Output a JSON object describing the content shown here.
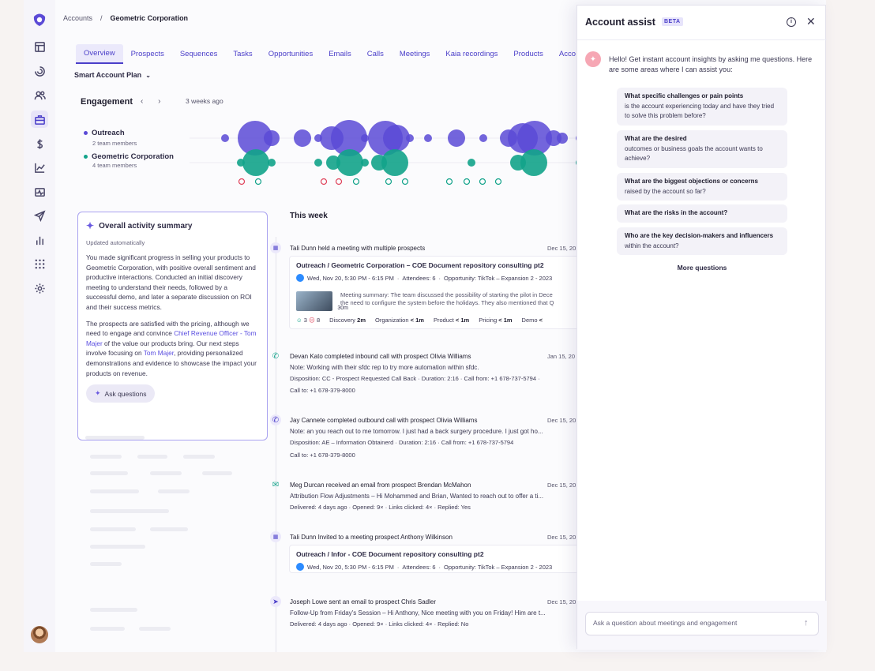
{
  "breadcrumb": {
    "root": "Accounts",
    "sep": "/",
    "current": "Geometric Corporation"
  },
  "tabs": [
    "Overview",
    "Prospects",
    "Sequences",
    "Tasks",
    "Opportunities",
    "Emails",
    "Calls",
    "Meetings",
    "Kaia recordings",
    "Products",
    "Acco"
  ],
  "plan": {
    "label": "Smart Account Plan",
    "chevron": "⌄"
  },
  "engagement": {
    "title": "Engagement",
    "nav": "‹ ›",
    "range": "3 weeks ago",
    "rows": [
      {
        "label": "Outreach",
        "sub": "2 team members",
        "color": "#5b4ad6"
      },
      {
        "label": "Geometric Corporation",
        "sub": "4 team members",
        "color": "#12a38a"
      }
    ]
  },
  "summary": {
    "title": "Overall activity summary",
    "updated": "Updated automatically",
    "p1": "You made significant progress in selling your products to Geometric Corporation, with positive overall sentiment and productive interactions. Conducted an initial discovery meeting to understand their needs, followed by a successful demo, and later a separate discussion on ROI and their success metrics.",
    "p2a": "The prospects are satisfied with the pricing, although we need to engage and convince ",
    "link1": "Chief Revenue Officer - Tom Majer",
    "p2b": " of the value our products bring. Our next steps involve focusing on ",
    "link2": "Tom Majer",
    "p2c": ", providing personalized demonstrations and evidence to showcase the impact your products on revenue.",
    "ask": "Ask questions"
  },
  "timeline": {
    "heading": "This week",
    "e1": {
      "title": "Tali Dunn held a meeting with multiple prospects",
      "date": "Dec 15, 20",
      "card_title": "Outreach / Geometric Corporation – COE Document repository consulting pt2",
      "when": "Wed, Nov 20, 5:30 PM - 6:15 PM",
      "attendees": "Attendees: 6",
      "opportunity": "Opportunity: TikTok – Expansion 2 - 2023",
      "duration": "30m",
      "summary1": "Meeting summary: The team discussed the possibility of starting the pilot in Dece",
      "summary2": "the need to configure the system before the holidays. They also mentioned that Q",
      "pos": "3",
      "neg": "8",
      "s1": "Discovery",
      "v1": "2m",
      "s2": "Organization",
      "v2": "< 1m",
      "s3": "Product",
      "v3": "< 1m",
      "s4": "Pricing",
      "v4": "< 1m",
      "s5": "Demo",
      "v5": "<"
    },
    "e2": {
      "title": "Devan Kato completed inbound call with prospect Olivia Williams",
      "date": "Jan 15, 20",
      "note": "Note: Working with their sfdc rep to try more automation within sfdc.",
      "meta": "Disposition: CC - Prospect Requested Call Back  ·  Duration: 2:16  ·  Call from: +1 678-737-5794  ·",
      "callto": "Call to:  +1 678-379-8000"
    },
    "e3": {
      "title": "Jay Cannete completed outbound call with prospect Olivia Williams",
      "date": "Dec 15, 20",
      "note": "Note: an you reach out to me tomorrow. I just had a back surgery procedure. I just got ho...",
      "meta": "Disposition: AE – Information Obtainerd  ·  Duration: 2:16  ·  Call from: +1 678-737-5794",
      "callto": "Call to:  +1 678-379-8000"
    },
    "e4": {
      "title": "Meg Durcan received an email from prospect Brendan McMahon",
      "date": "Dec 15, 20",
      "line": "Attribution Flow Adjustments – Hi Mohammed and Brian, Wanted to reach out to offer a ti...",
      "meta": "Delivered: 4 days ago  ·  Opened: 9×  ·  Links clicked: 4×  ·  Replied: Yes"
    },
    "e5": {
      "title": "Tali Dunn Invited to a meeting prospect Anthony Wilkinson",
      "date": "Dec 15, 20",
      "card_title": "Outreach / Infor - COE Document repository consulting pt2",
      "when": "Wed, Nov 20, 5:30 PM - 6:15 PM",
      "attendees": "Attendees: 6",
      "opportunity": "Opportunity: TikTok – Expansion 2 - 2023"
    },
    "e6": {
      "title": "Joseph Lowe sent an email to prospect Chris Sadler",
      "date": "Dec 15, 20",
      "line": "Follow-Up from Friday's Session – Hi Anthony, Nice meeting with you on Friday! Him are t...",
      "meta": "Delivered: 4 days ago  ·  Opened: 9×  ·  Links clicked: 4×  ·  Replied: No"
    }
  },
  "assist": {
    "title": "Account assist",
    "beta": "BETA",
    "greeting": "Hello! Get instant account insights by asking me questions. Here are some areas where I can assist you:",
    "questions": [
      {
        "bold": "What specific challenges or pain points",
        "rest": "is the account experiencing today and have they tried to solve this problem before?"
      },
      {
        "bold": "What are the desired",
        "rest": "outcomes or business goals the account wants to achieve?"
      },
      {
        "bold": "What are the biggest objections or concerns",
        "rest": "raised by the account so far?"
      },
      {
        "bold": "What are the risks in the account?",
        "rest": ""
      },
      {
        "bold": "Who are the key decision-makers and influencers",
        "rest": "within the account?"
      }
    ],
    "more": "More questions",
    "placeholder": "Ask a question about meetings and engagement"
  },
  "colors": {
    "accent": "#4b3fc9",
    "outreach": "#5b4ad6",
    "customer": "#12a38a",
    "negative": "#e0435b"
  }
}
